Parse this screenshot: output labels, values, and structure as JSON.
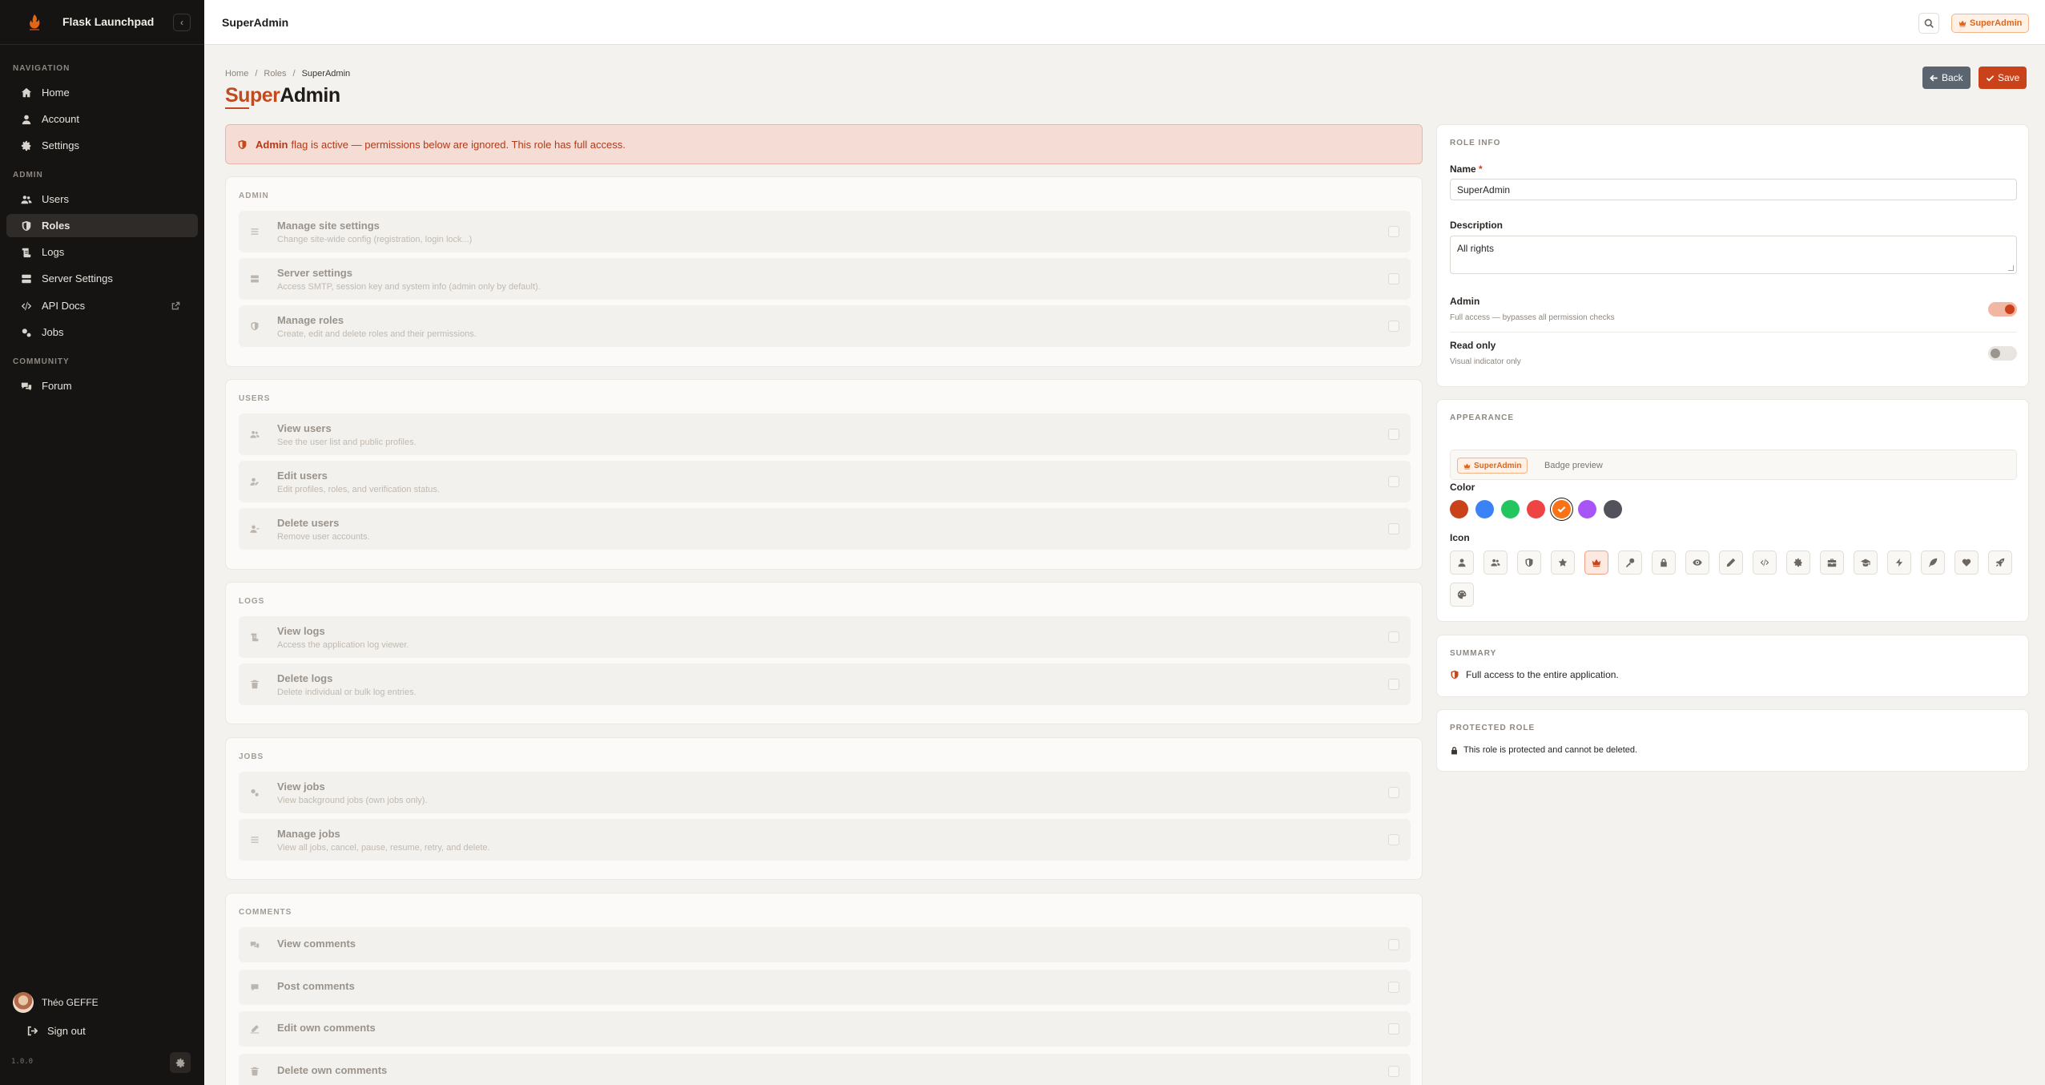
{
  "app": {
    "name": "Flask Launchpad",
    "version": "1.0.0"
  },
  "sidebar": {
    "sections": [
      {
        "label": "NAVIGATION"
      },
      {
        "label": "ADMIN"
      },
      {
        "label": "COMMUNITY"
      }
    ],
    "items": [
      {
        "label": "Home",
        "icon": "home-icon"
      },
      {
        "label": "Account",
        "icon": "user-icon"
      },
      {
        "label": "Settings",
        "icon": "gear-icon"
      },
      {
        "label": "Users",
        "icon": "users-icon"
      },
      {
        "label": "Roles",
        "icon": "shield-icon",
        "active": true
      },
      {
        "label": "Logs",
        "icon": "scroll-icon"
      },
      {
        "label": "Server Settings",
        "icon": "server-icon"
      },
      {
        "label": "API Docs",
        "icon": "code-icon",
        "external": true
      },
      {
        "label": "Jobs",
        "icon": "cogs-icon"
      },
      {
        "label": "Forum",
        "icon": "comments-icon"
      }
    ],
    "user": {
      "name": "Théo GEFFE",
      "signout_label": "Sign out"
    }
  },
  "topbar": {
    "title": "SuperAdmin",
    "badge_label": "SuperAdmin"
  },
  "page": {
    "breadcrumb": [
      "Home",
      "Roles",
      "SuperAdmin"
    ],
    "breadcrumb_sep": "/",
    "title_accent": "Super",
    "title_rest": "Admin",
    "back_label": "Back",
    "save_label": "Save"
  },
  "alert": {
    "bold": "Admin",
    "text": "flag is active — permissions below are ignored. This role has full access."
  },
  "permissions": [
    {
      "section": "ADMIN",
      "rows": [
        {
          "name": "Manage site settings",
          "desc": "Change site-wide config (registration, login lock...)",
          "icon": "sliders-icon"
        },
        {
          "name": "Server settings",
          "desc": "Access SMTP, session key and system info (admin only by default).",
          "icon": "server-icon"
        },
        {
          "name": "Manage roles",
          "desc": "Create, edit and delete roles and their permissions.",
          "icon": "shield-icon"
        }
      ]
    },
    {
      "section": "USERS",
      "rows": [
        {
          "name": "View users",
          "desc": "See the user list and public profiles.",
          "icon": "users-icon"
        },
        {
          "name": "Edit users",
          "desc": "Edit profiles, roles, and verification status.",
          "icon": "user-edit-icon"
        },
        {
          "name": "Delete users",
          "desc": "Remove user accounts.",
          "icon": "user-minus-icon"
        }
      ]
    },
    {
      "section": "LOGS",
      "rows": [
        {
          "name": "View logs",
          "desc": "Access the application log viewer.",
          "icon": "scroll-icon"
        },
        {
          "name": "Delete logs",
          "desc": "Delete individual or bulk log entries.",
          "icon": "trash-icon"
        }
      ]
    },
    {
      "section": "JOBS",
      "rows": [
        {
          "name": "View jobs",
          "desc": "View background jobs (own jobs only).",
          "icon": "cogs-icon"
        },
        {
          "name": "Manage jobs",
          "desc": "View all jobs, cancel, pause, resume, retry, and delete.",
          "icon": "list-icon"
        }
      ]
    },
    {
      "section": "COMMENTS",
      "rows": [
        {
          "name": "View comments",
          "desc": "",
          "icon": "comments-icon"
        },
        {
          "name": "Post comments",
          "desc": "",
          "icon": "comment-icon"
        },
        {
          "name": "Edit own comments",
          "desc": "",
          "icon": "edit-icon"
        },
        {
          "name": "Delete own comments",
          "desc": "",
          "icon": "trash-icon"
        }
      ]
    }
  ],
  "role_info": {
    "section": "ROLE INFO",
    "name_label": "Name",
    "name_required": "*",
    "name_value": "SuperAdmin",
    "description_label": "Description",
    "description_value": "All rights",
    "admin_label": "Admin",
    "admin_desc": "Full access — bypasses all permission checks",
    "admin_on": true,
    "readonly_label": "Read only",
    "readonly_desc": "Visual indicator only",
    "readonly_on": false
  },
  "appearance": {
    "section": "APPEARANCE",
    "badge_label": "SuperAdmin",
    "badge_caption": "Badge preview",
    "color_label": "Color",
    "colors": [
      "#c9421a",
      "#3b82f6",
      "#22c55e",
      "#ef4444",
      "#f97316",
      "#a855f7",
      "#52525b"
    ],
    "selected_color_index": 4,
    "icon_label": "Icon",
    "icons": [
      "user-icon",
      "users-icon",
      "shield-icon",
      "star-icon",
      "crown-icon",
      "key-icon",
      "lock-icon",
      "eye-icon",
      "pencil-icon",
      "code-icon",
      "gear-icon",
      "briefcase-icon",
      "graduation-cap-icon",
      "bolt-icon",
      "feather-icon",
      "heart-icon",
      "rocket-icon",
      "palette-icon"
    ],
    "selected_icon_index": 4
  },
  "summary": {
    "section": "SUMMARY",
    "text": "Full access to the entire application."
  },
  "protected": {
    "section": "PROTECTED ROLE",
    "text": "This role is protected and cannot be deleted."
  }
}
